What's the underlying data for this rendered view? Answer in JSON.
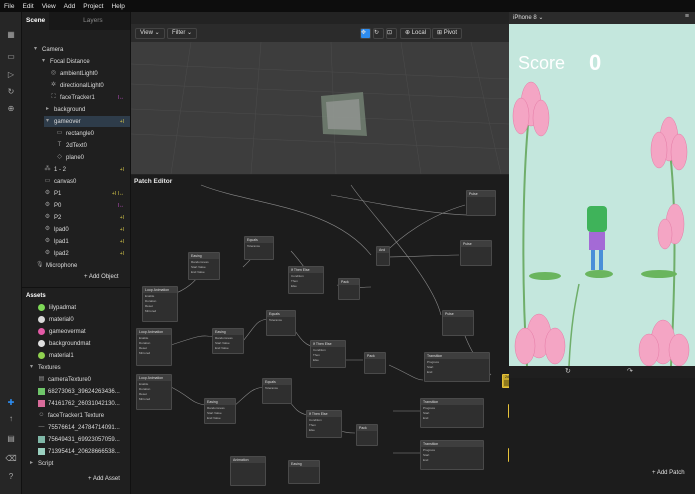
{
  "menu": [
    "File",
    "Edit",
    "View",
    "Add",
    "Project",
    "Help"
  ],
  "scene_panel": {
    "tabs": [
      "Scene",
      "Layers"
    ],
    "tree": [
      {
        "label": "Camera",
        "indent": 1
      },
      {
        "label": "Focal Distance",
        "indent": 2
      },
      {
        "label": "ambientLight0",
        "indent": 3
      },
      {
        "label": "directionalLight0",
        "indent": 3
      },
      {
        "label": "faceTracker1",
        "indent": 3,
        "flag": "I↔"
      },
      {
        "label": "background",
        "indent": 3
      },
      {
        "label": "gameover",
        "indent": 3,
        "flag": "+I"
      },
      {
        "label": "rectangle0",
        "indent": 4
      },
      {
        "label": "2dText0",
        "indent": 4
      },
      {
        "label": "plane0",
        "indent": 4
      },
      {
        "label": "1 - 2",
        "indent": 3,
        "flag": "+I"
      },
      {
        "label": "canvas0",
        "indent": 3
      },
      {
        "label": "P1",
        "indent": 3,
        "flag": "+I I↔"
      },
      {
        "label": "P0",
        "indent": 3,
        "flag": "I↔"
      },
      {
        "label": "P2",
        "indent": 3,
        "flag": "+I"
      },
      {
        "label": "lpad0",
        "indent": 3,
        "flag": "+I"
      },
      {
        "label": "lpad1",
        "indent": 3,
        "flag": "+I"
      },
      {
        "label": "lpad2",
        "indent": 3,
        "flag": "+I"
      },
      {
        "label": "Microphone",
        "indent": 2
      }
    ],
    "add_object": "+ Add Object"
  },
  "assets_panel": {
    "title": "Assets",
    "materials": [
      {
        "label": "lilypadmat",
        "color": "#7ed957"
      },
      {
        "label": "material0",
        "color": "#d9d9d9"
      },
      {
        "label": "gameovermat",
        "color": "#e35aa6"
      },
      {
        "label": "backgroundmat",
        "color": "#e0e0e0"
      },
      {
        "label": "material1",
        "color": "#8fd14f"
      }
    ],
    "textures_label": "Textures",
    "textures": [
      {
        "label": "cameraTexture0"
      },
      {
        "label": "68273063_39624263436..."
      },
      {
        "label": "74161762_26031042130..."
      },
      {
        "label": "faceTracker1 Texture"
      },
      {
        "label": "75576614_24784714091..."
      },
      {
        "label": "75649431_69923057059..."
      },
      {
        "label": "71395414_20628666538..."
      }
    ],
    "script_label": "Script",
    "add_asset": "+ Add Asset"
  },
  "viewport": {
    "view_label": "View",
    "filter_label": "Filter",
    "local_label": "Local",
    "pivot_label": "Pivot"
  },
  "patch_editor": {
    "title": "Patch Editor",
    "add_patch": "+ Add Patch",
    "nodes": {
      "loop": "Loop Animation",
      "easing": "Easing",
      "equals": "Equals",
      "ifthen": "If Then Else",
      "and": "And",
      "pack": "Pack",
      "pulse": "Pulse",
      "transition": "Transition",
      "animation": "Animation"
    },
    "node_fields": {
      "enable": "Enable",
      "duration": "Duration",
      "reset": "Reset",
      "mirrored": "Mirrored",
      "randomness": "Randomness",
      "start_value": "Start Value",
      "end_value": "End Value",
      "condition": "Condition",
      "then": "Then",
      "else": "Else",
      "tolerance": "Tolerance",
      "progress": "Progress",
      "start": "Start",
      "end": "End",
      "curve": "Curve",
      "linear": "Linear",
      "position": "2d Position"
    }
  },
  "preview": {
    "device": "iPhone 8",
    "score_label": "Score",
    "score_value": "0"
  }
}
